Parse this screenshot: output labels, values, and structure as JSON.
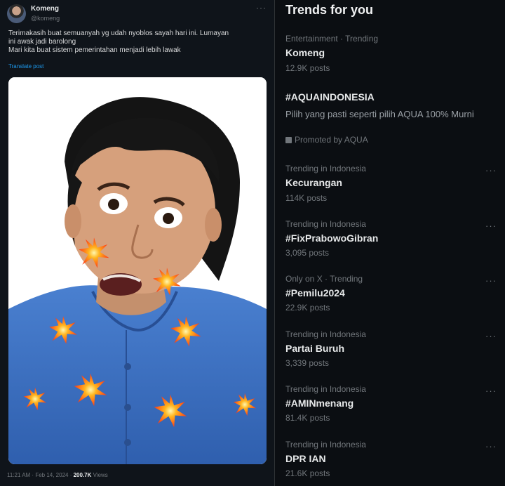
{
  "tweet": {
    "author_name": "Komeng",
    "author_handle": "@komeng",
    "more_icon": "more-horizontal-icon",
    "text_lines": [
      "Terimakasih buat semuanyah yg udah nyoblos sayah hari ini. Lumayan",
      "ini awak jadi barolong",
      "Mari kita buat sistem pemerintahan menjadi lebih lawak"
    ],
    "translate_label": "Translate post",
    "time": "11:21 AM · Feb 14, 2024 · ",
    "views_count": "200.7K",
    "views_label": " Views"
  },
  "trends": {
    "title": "Trends for you",
    "items": [
      {
        "meta": "Entertainment · Trending",
        "name": "Komeng",
        "count": "12.9K posts"
      },
      {
        "meta": "",
        "name": "#AQUAINDONESIA",
        "description": "Pilih yang pasti seperti pilih AQUA 100% Murni",
        "promoted": "Promoted by AQUA"
      },
      {
        "meta": "Trending in Indonesia",
        "name": "Kecurangan",
        "count": "114K posts"
      },
      {
        "meta": "Trending in Indonesia",
        "name": "#FixPrabowoGibran",
        "count": "3,095 posts"
      },
      {
        "meta": "Only on X · Trending",
        "name": "#Pemilu2024",
        "count": "22.9K posts"
      },
      {
        "meta": "Trending in Indonesia",
        "name": "Partai Buruh",
        "count": "3,339 posts"
      },
      {
        "meta": "Trending in Indonesia",
        "name": "#AMINmenang",
        "count": "81.4K posts"
      },
      {
        "meta": "Trending in Indonesia",
        "name": "DPR IAN",
        "count": "21.6K posts"
      }
    ],
    "more_label": "···"
  },
  "colors": {
    "background": "#000000",
    "accent": "#1d9bf0",
    "muted": "#71767b",
    "shirt": "#3a6fc4",
    "burst": "#ff4e16"
  }
}
